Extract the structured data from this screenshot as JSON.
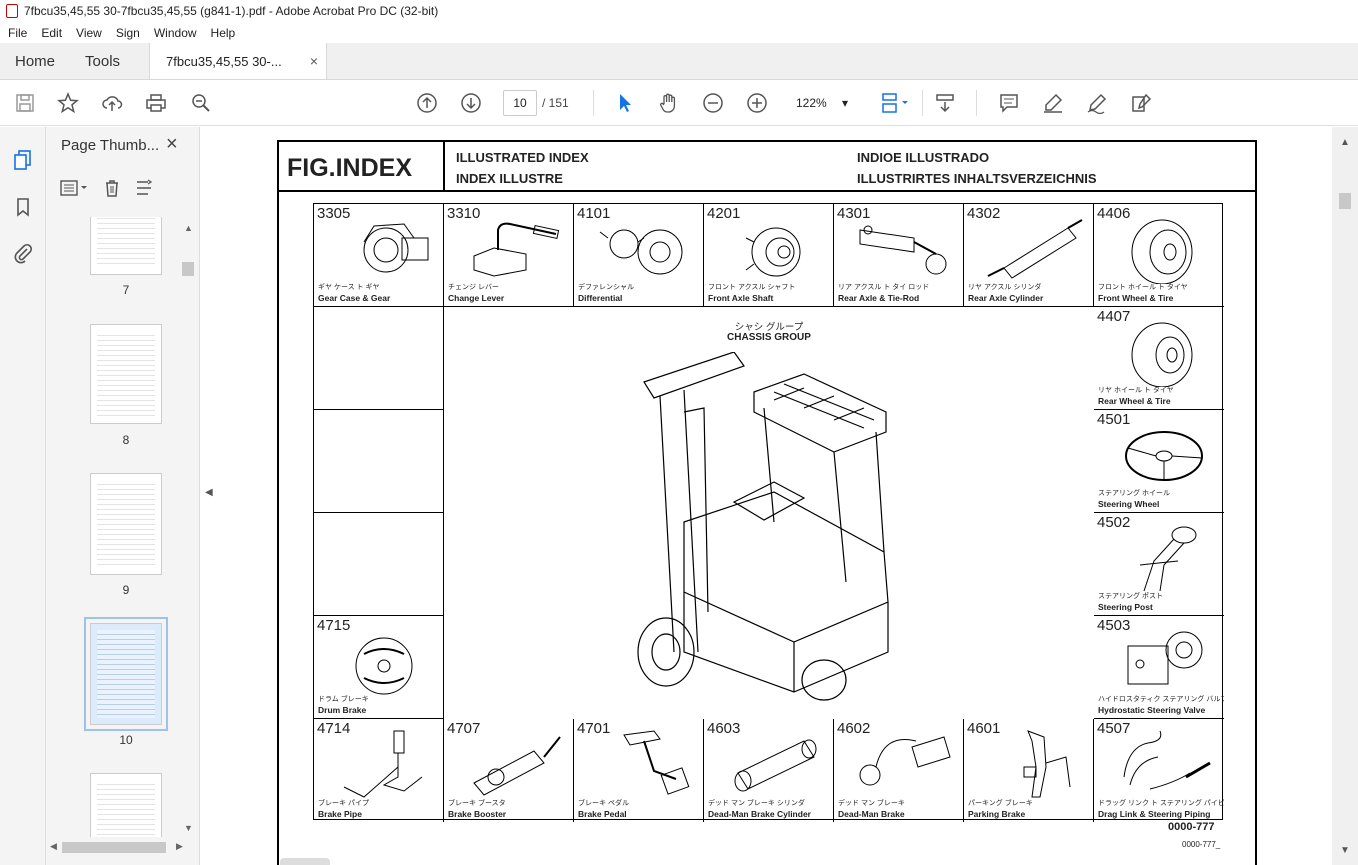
{
  "window": {
    "title": "7fbcu35,45,55 30-7fbcu35,45,55 (g841-1).pdf - Adobe Acrobat Pro DC (32-bit)"
  },
  "menu": [
    "File",
    "Edit",
    "View",
    "Sign",
    "Window",
    "Help"
  ],
  "tabs": {
    "home": "Home",
    "tools": "Tools",
    "doc": "7fbcu35,45,55 30-...",
    "doc_close": "×"
  },
  "toolbar": {
    "page_current": "10",
    "page_total": "/ 151",
    "zoom": "122%"
  },
  "thumbnails": {
    "title": "Page Thumb...",
    "close": "×",
    "pages": [
      {
        "label": "7"
      },
      {
        "label": "8"
      },
      {
        "label": "9"
      },
      {
        "label": "10",
        "selected": true
      },
      {
        "label": ""
      }
    ]
  },
  "document": {
    "fig_title": "FIG.INDEX",
    "header": {
      "en": "ILLUSTRATED INDEX",
      "fr": "INDEX ILLUSTRE",
      "es": "INDIOE ILLUSTRADO",
      "de": "ILLUSTRIRTES INHALTSVERZEICHNIS"
    },
    "center": {
      "jp": "シャシ グループ",
      "en": "CHASSIS GROUP"
    },
    "parts": [
      {
        "num": "3305",
        "jp": "ギヤ ケース ト ギヤ",
        "en": "Gear Case & Gear"
      },
      {
        "num": "3310",
        "jp": "チェンジ レバー",
        "en": "Change Lever"
      },
      {
        "num": "4101",
        "jp": "デファレンシャル",
        "en": "Differential"
      },
      {
        "num": "4201",
        "jp": "フロント アクスル シャフト",
        "en": "Front Axle Shaft"
      },
      {
        "num": "4301",
        "jp": "リア アクスル ト タイ ロッド",
        "en": "Rear Axle & Tie-Rod"
      },
      {
        "num": "4302",
        "jp": "リヤ アクスル シリンダ",
        "en": "Rear Axle Cylinder"
      },
      {
        "num": "4406",
        "jp": "フロント ホイール ト タイヤ",
        "en": "Front Wheel & Tire"
      },
      {
        "num": "4407",
        "jp": "リヤ ホイール ト タイヤ",
        "en": "Rear Wheel & Tire"
      },
      {
        "num": "4501",
        "jp": "ステアリング ホイール",
        "en": "Steering Wheel"
      },
      {
        "num": "4502",
        "jp": "ステアリング ポスト",
        "en": "Steering Post"
      },
      {
        "num": "4503",
        "jp": "ハイドロスタティク ステアリング バルブ",
        "en": "Hydrostatic Steering Valve"
      },
      {
        "num": "4715",
        "jp": "ドラム ブレーキ",
        "en": "Drum Brake"
      },
      {
        "num": "4714",
        "jp": "ブレーキ パイプ",
        "en": "Brake Pipe"
      },
      {
        "num": "4707",
        "jp": "ブレーキ ブースタ",
        "en": "Brake Booster"
      },
      {
        "num": "4701",
        "jp": "ブレーキ ペダル",
        "en": "Brake Pedal"
      },
      {
        "num": "4603",
        "jp": "デッド マン ブレーキ シリンダ",
        "en": "Dead-Man Brake Cylinder"
      },
      {
        "num": "4602",
        "jp": "デッド マン ブレーキ",
        "en": "Dead-Man Brake"
      },
      {
        "num": "4601",
        "jp": "パーキング ブレーキ",
        "en": "Parking Brake"
      },
      {
        "num": "4507",
        "jp": "ドラッグ リンク ト ステアリング パイピング",
        "en": "Drag Link & Steering Piping"
      }
    ],
    "code_main": "0000-777",
    "code_small": "0000-777_"
  }
}
